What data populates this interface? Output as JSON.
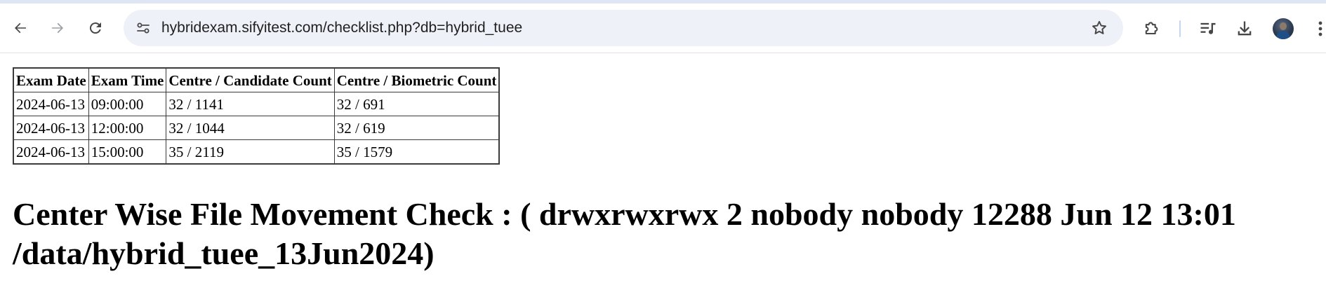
{
  "browser": {
    "url": "hybridexam.sifyitest.com/checklist.php?db=hybrid_tuee",
    "icons": {
      "back": "back-arrow-icon",
      "forward": "forward-arrow-icon",
      "reload": "reload-icon",
      "site_info": "site-info-tune-icon",
      "bookmark": "star-outline-icon",
      "extensions": "puzzle-piece-icon",
      "media": "playlist-music-icon",
      "downloads": "download-icon",
      "menu": "three-dot-menu-icon"
    },
    "colors": {
      "omnibox_bg": "#eef1f8",
      "tab_strip": "#dfe6f3",
      "icon": "#474747"
    }
  },
  "table": {
    "headers": [
      "Exam Date",
      "Exam Time",
      "Centre / Candidate Count",
      "Centre / Biometric Count"
    ],
    "rows": [
      [
        "2024-06-13",
        "09:00:00",
        "32 / 1141",
        "32 / 691"
      ],
      [
        "2024-06-13",
        "12:00:00",
        "32 / 1044",
        "32 / 619"
      ],
      [
        "2024-06-13",
        "15:00:00",
        "35 / 2119",
        "35 / 1579"
      ]
    ]
  },
  "heading": "Center Wise File Movement Check : ( drwxrwxrwx 2 nobody nobody 12288 Jun 12 13:01 /data/hybrid_tuee_13Jun2024)"
}
